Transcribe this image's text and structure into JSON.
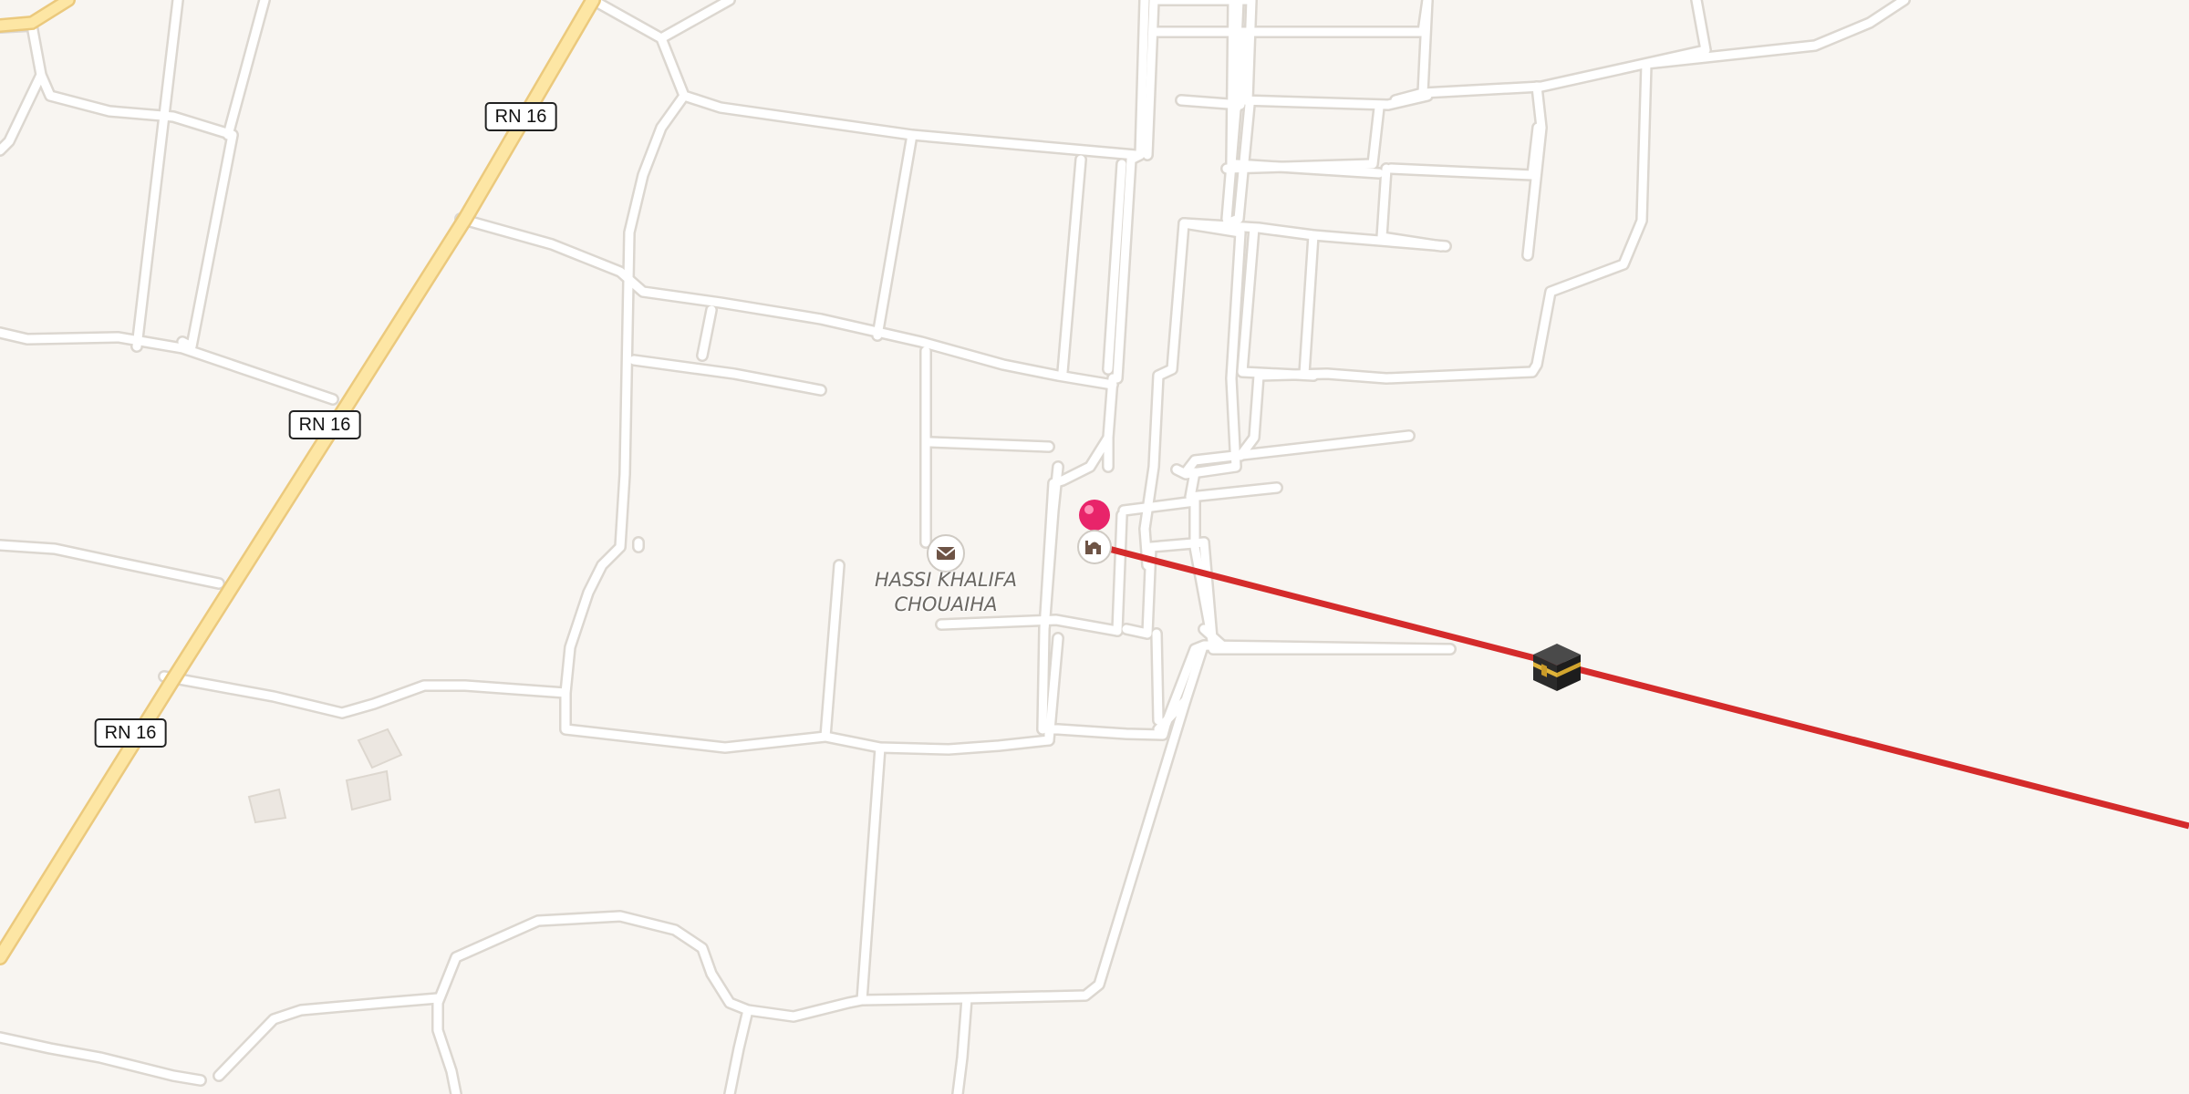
{
  "map": {
    "road_shields": [
      {
        "label": "RN 16"
      },
      {
        "label": "RN 16"
      },
      {
        "label": "RN 16"
      }
    ],
    "place": {
      "line1": "HASSI KHALIFA",
      "line2": "CHOUAIHA"
    },
    "icons": {
      "post_office": "envelope-icon",
      "mosque": "mosque-icon",
      "kaaba": "kaaba-icon",
      "pin": "location-pin-icon"
    },
    "colors": {
      "background": "#f8f5f1",
      "road": "#ffffff",
      "road_casing": "#dcd7d0",
      "highway": "#fde6a4",
      "highway_casing": "#ebc97d",
      "qibla_line": "#d42b2b",
      "pin": "#e8246a",
      "building": "#ece7e1"
    }
  }
}
